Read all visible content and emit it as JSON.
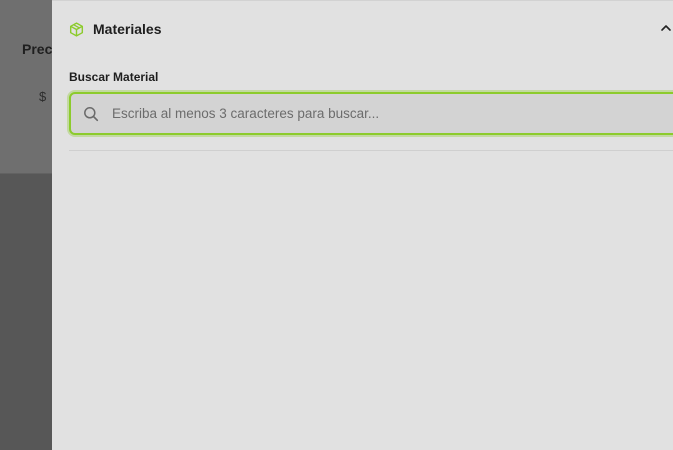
{
  "background": {
    "label": "Preci",
    "currency": "$"
  },
  "section": {
    "title": "Materiales",
    "icon": "cube-icon",
    "toggle_icon": "chevron-up-icon"
  },
  "search": {
    "label": "Buscar Material",
    "placeholder": "Escriba al menos 3 caracteres para buscar...",
    "value": "",
    "icon": "search-icon"
  },
  "colors": {
    "accent": "#8ccb2c",
    "drawer_bg": "#e1e1e1",
    "overlay_bg": "#575757"
  }
}
